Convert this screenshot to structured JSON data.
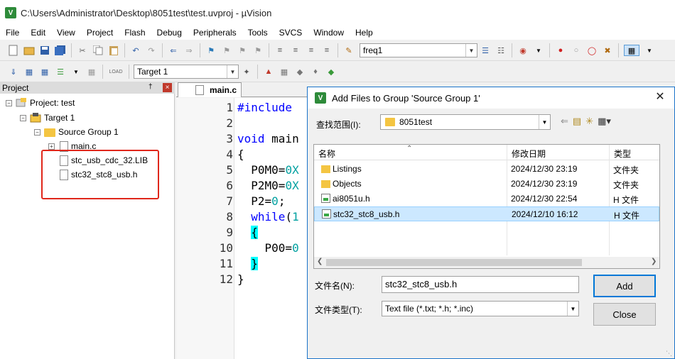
{
  "window": {
    "title": "C:\\Users\\Administrator\\Desktop\\8051test\\test.uvproj - µVision",
    "app_icon": "V"
  },
  "menu": [
    "File",
    "Edit",
    "View",
    "Project",
    "Flash",
    "Debug",
    "Peripherals",
    "Tools",
    "SVCS",
    "Window",
    "Help"
  ],
  "toolbar1": {
    "find_combo_value": "freq1"
  },
  "toolbar2": {
    "target_combo_value": "Target 1",
    "load_label": "LOAD"
  },
  "project_panel": {
    "header": "Project",
    "pin": "†",
    "close": "×",
    "tree": [
      {
        "label": "Project: test",
        "expander": "−"
      },
      {
        "label": "Target 1",
        "expander": "−"
      },
      {
        "label": "Source Group 1",
        "expander": "−"
      },
      {
        "label": "main.c",
        "expander": "+"
      },
      {
        "label": "stc_usb_cdc_32.LIB"
      },
      {
        "label": "stc32_stc8_usb.h"
      }
    ]
  },
  "editor": {
    "tab_label": "main.c",
    "lines": [
      {
        "n": "1",
        "segments": [
          {
            "t": "#include",
            "c": "kw"
          },
          {
            "t": " ",
            "c": ""
          }
        ]
      },
      {
        "n": "2",
        "segments": []
      },
      {
        "n": "3",
        "segments": [
          {
            "t": "void",
            "c": "kw"
          },
          {
            "t": " main",
            "c": ""
          }
        ]
      },
      {
        "n": "4",
        "segments": [
          {
            "t": "{",
            "c": ""
          }
        ]
      },
      {
        "n": "5",
        "segments": [
          {
            "t": "  P0M0=",
            "c": ""
          },
          {
            "t": "0X",
            "c": "num"
          }
        ]
      },
      {
        "n": "6",
        "segments": [
          {
            "t": "  P2M0=",
            "c": ""
          },
          {
            "t": "0X",
            "c": "num"
          }
        ]
      },
      {
        "n": "7",
        "segments": [
          {
            "t": "  P2=",
            "c": ""
          },
          {
            "t": "0",
            "c": "num"
          },
          {
            "t": ";",
            "c": ""
          }
        ]
      },
      {
        "n": "8",
        "segments": [
          {
            "t": "  ",
            "c": ""
          },
          {
            "t": "while",
            "c": "kw"
          },
          {
            "t": "(",
            "c": ""
          },
          {
            "t": "1",
            "c": "num"
          }
        ]
      },
      {
        "n": "9",
        "segments": [
          {
            "t": "  ",
            "c": ""
          },
          {
            "t": "{",
            "c": "brace"
          }
        ]
      },
      {
        "n": "10",
        "segments": [
          {
            "t": "    P00=",
            "c": ""
          },
          {
            "t": "0",
            "c": "num"
          }
        ]
      },
      {
        "n": "11",
        "segments": [
          {
            "t": "  ",
            "c": ""
          },
          {
            "t": "}",
            "c": "brace"
          }
        ]
      },
      {
        "n": "12",
        "segments": [
          {
            "t": "}",
            "c": ""
          }
        ]
      }
    ]
  },
  "dialog": {
    "title": "Add Files to Group 'Source Group 1'",
    "close": "✕",
    "look_in_label": "查找范围(I):",
    "look_in_value": "8051test",
    "columns": {
      "name": "名称",
      "modified": "修改日期",
      "type": "类型"
    },
    "files": [
      {
        "name": "Listings",
        "modified": "2024/12/30 23:19",
        "type": "文件夹",
        "kind": "folder"
      },
      {
        "name": "Objects",
        "modified": "2024/12/30 23:19",
        "type": "文件夹",
        "kind": "folder"
      },
      {
        "name": "ai8051u.h",
        "modified": "2024/12/30 22:54",
        "type": "H 文件",
        "kind": "hfile"
      },
      {
        "name": "stc32_stc8_usb.h",
        "modified": "2024/12/10 16:12",
        "type": "H 文件",
        "kind": "hfile",
        "selected": true
      }
    ],
    "filename_label": "文件名(N):",
    "filename_value": "stc32_stc8_usb.h",
    "filetype_label": "文件类型(T):",
    "filetype_value": "Text file (*.txt; *.h; *.inc)",
    "add_button": "Add",
    "close_button": "Close"
  }
}
